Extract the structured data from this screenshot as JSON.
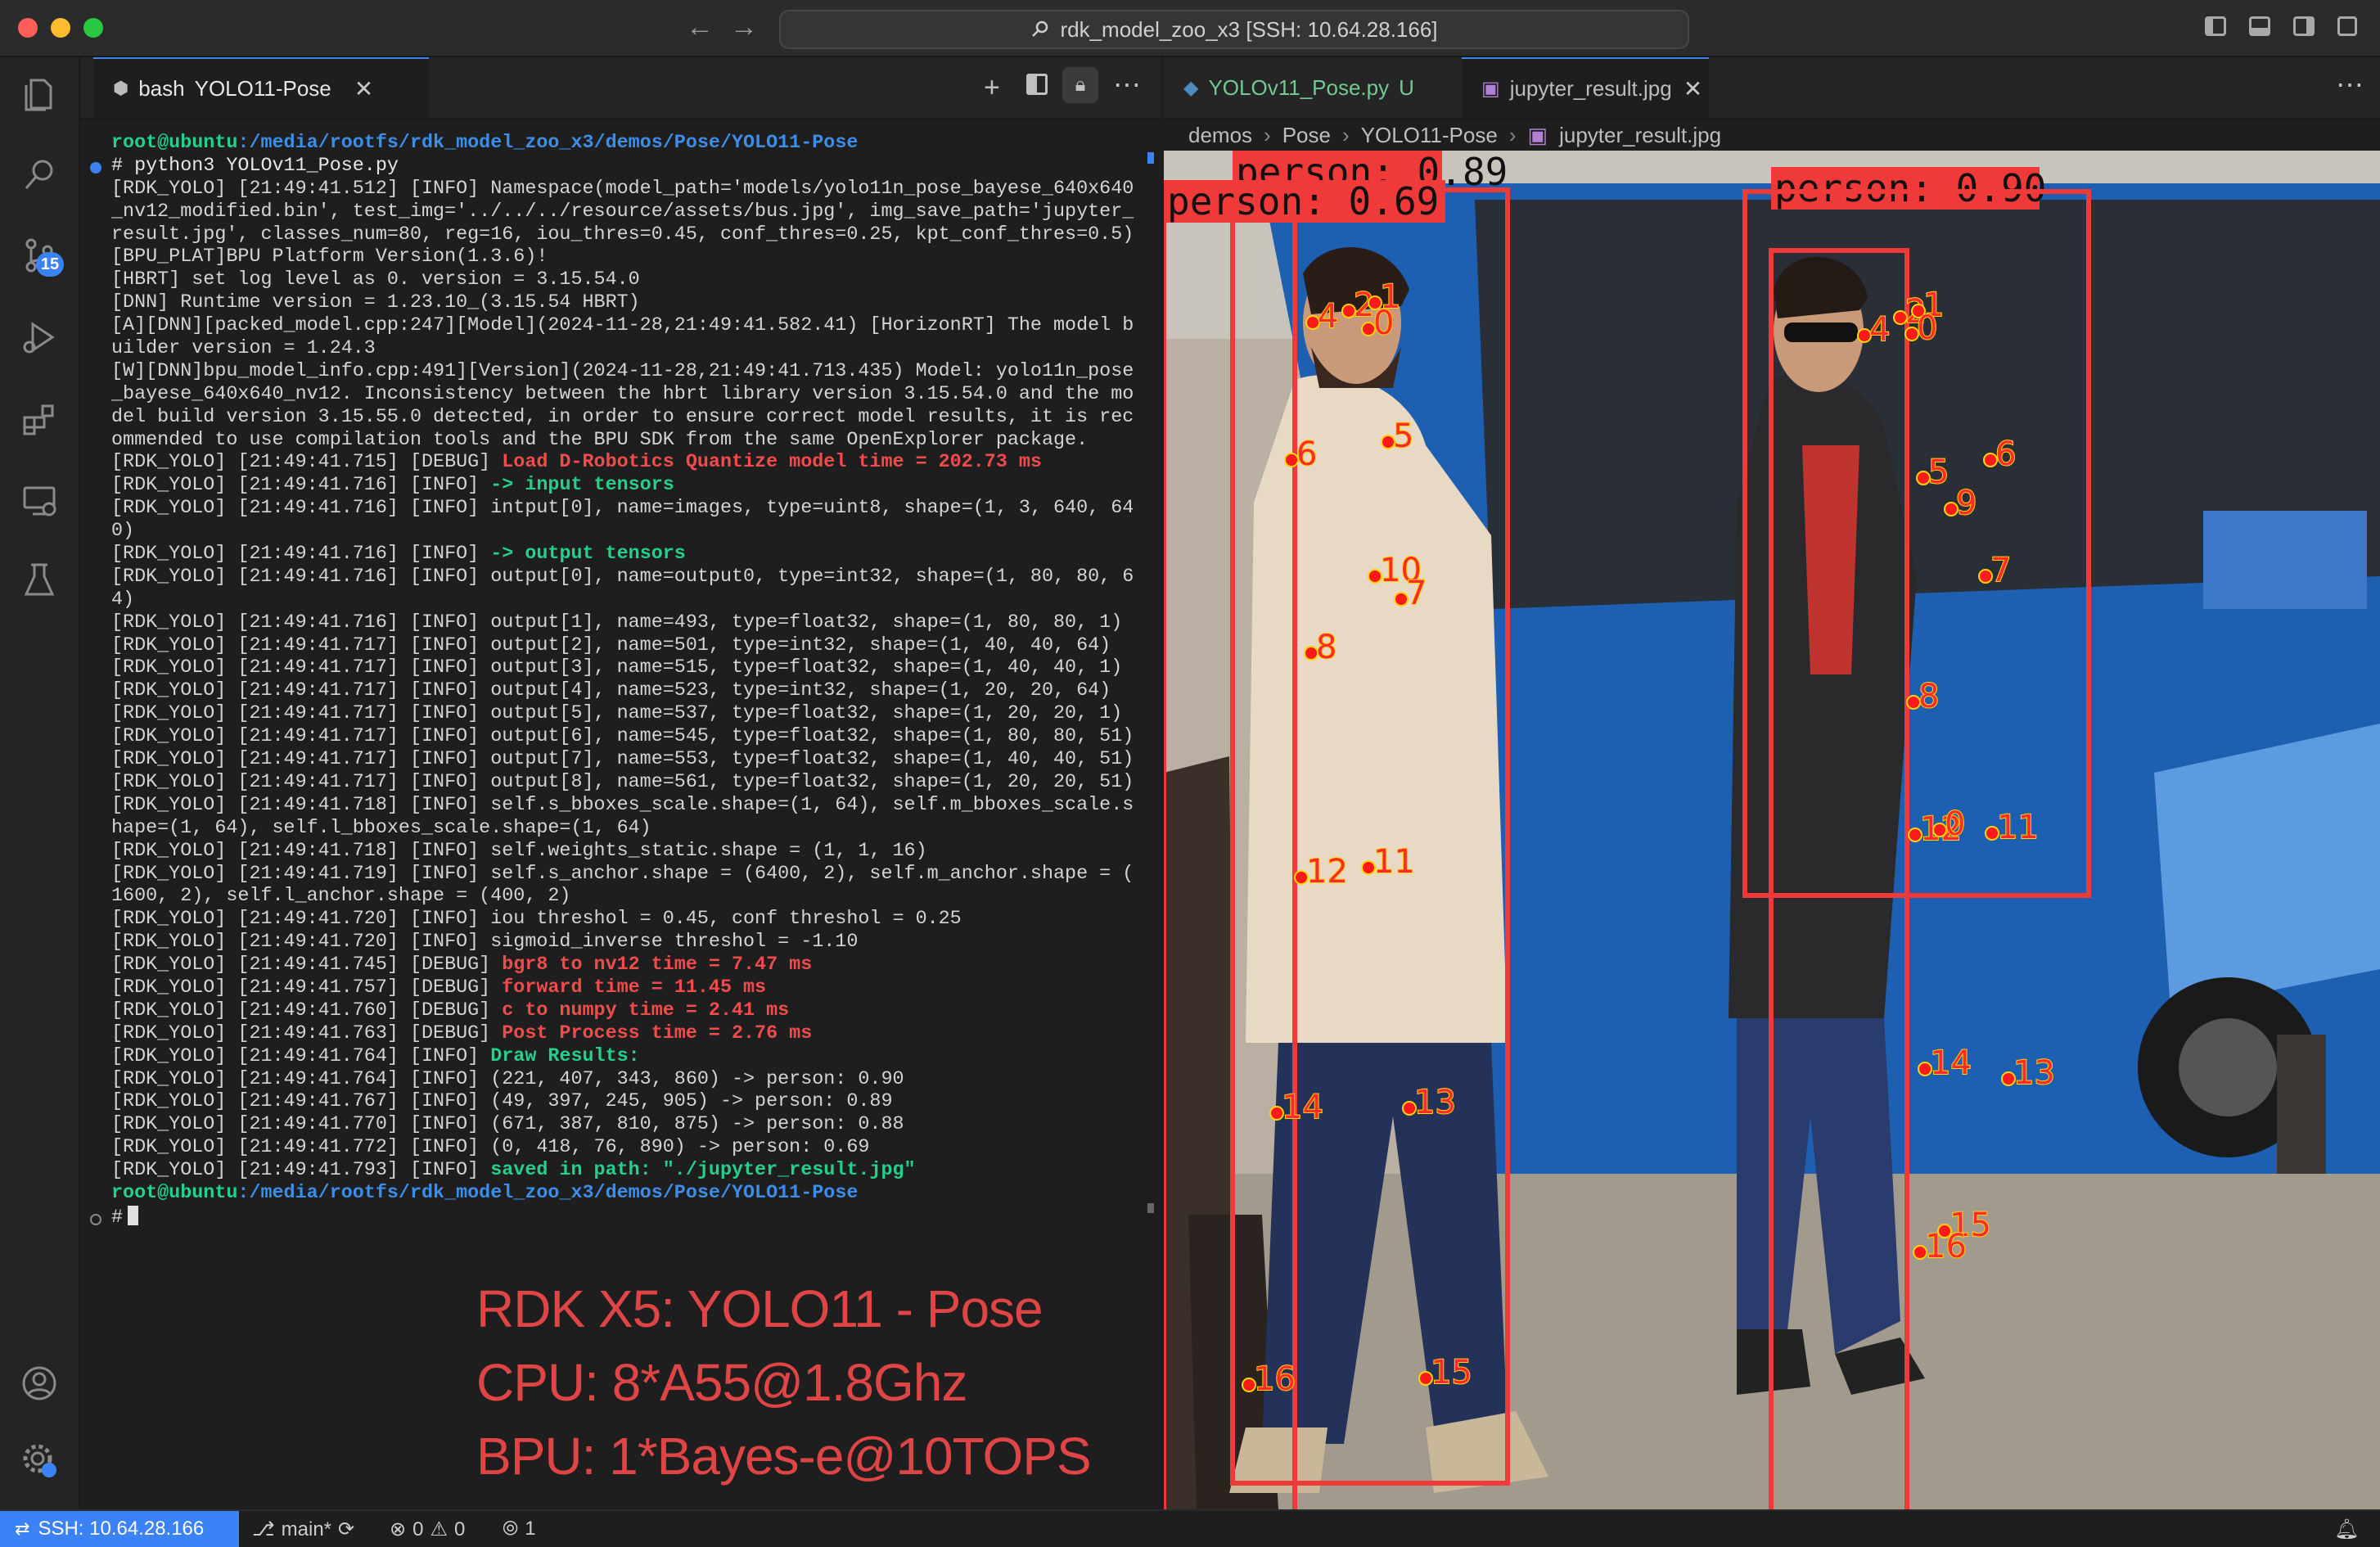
{
  "window": {
    "title": "rdk_model_zoo_x3 [SSH: 10.64.28.166]"
  },
  "activity": {
    "scm_badge": "15"
  },
  "terminal": {
    "tab_label": "bash",
    "tab_title": "YOLO11-Pose",
    "prompt_user": "root@ubuntu",
    "prompt_path": ":/media/rootfs/rdk_model_zoo_x3/demos/Pose/YOLO11-Pose",
    "command": "# python3 YOLOv11_Pose.py",
    "final_prompt": "#",
    "log_lines": [
      {
        "t": "[RDK_YOLO] [21:49:41.512] [INFO] Namespace(model_path='models/yolo11n_pose_bayese_640x640",
        "hl": ""
      },
      {
        "t": "_nv12_modified.bin', test_img='../../../resource/assets/bus.jpg', img_save_path='jupyter_",
        "hl": ""
      },
      {
        "t": "result.jpg', classes_num=80, reg=16, iou_thres=0.45, conf_thres=0.25, kpt_conf_thres=0.5)",
        "hl": ""
      },
      {
        "t": "[BPU_PLAT]BPU Platform Version(1.3.6)!",
        "hl": ""
      },
      {
        "t": "[HBRT] set log level as 0. version = 3.15.54.0",
        "hl": ""
      },
      {
        "t": "[DNN] Runtime version = 1.23.10_(3.15.54 HBRT)",
        "hl": ""
      },
      {
        "t": "[A][DNN][packed_model.cpp:247][Model](2024-11-28,21:49:41.582.41) [HorizonRT] The model b",
        "hl": ""
      },
      {
        "t": "uilder version = 1.24.3",
        "hl": ""
      },
      {
        "t": "[W][DNN]bpu_model_info.cpp:491][Version](2024-11-28,21:49:41.713.435) Model: yolo11n_pose",
        "hl": ""
      },
      {
        "t": "_bayese_640x640_nv12. Inconsistency between the hbrt library version 3.15.54.0 and the mo",
        "hl": ""
      },
      {
        "t": "del build version 3.15.55.0 detected, in order to ensure correct model results, it is rec",
        "hl": ""
      },
      {
        "t": "ommended to use compilation tools and the BPU SDK from the same OpenExplorer package.",
        "hl": ""
      },
      {
        "t": "[RDK_YOLO] [21:49:41.715] [DEBUG] ",
        "hl": "Load D-Robotics Quantize model time = 202.73 ms",
        "c": "red"
      },
      {
        "t": "[RDK_YOLO] [21:49:41.716] [INFO] ",
        "hl": "-> input tensors",
        "c": "green"
      },
      {
        "t": "[RDK_YOLO] [21:49:41.716] [INFO] intput[0], name=images, type=uint8, shape=(1, 3, 640, 64",
        "hl": ""
      },
      {
        "t": "0)",
        "hl": ""
      },
      {
        "t": "[RDK_YOLO] [21:49:41.716] [INFO] ",
        "hl": "-> output tensors",
        "c": "green"
      },
      {
        "t": "[RDK_YOLO] [21:49:41.716] [INFO] output[0], name=output0, type=int32, shape=(1, 80, 80, 6",
        "hl": ""
      },
      {
        "t": "4)",
        "hl": ""
      },
      {
        "t": "[RDK_YOLO] [21:49:41.716] [INFO] output[1], name=493, type=float32, shape=(1, 80, 80, 1)",
        "hl": ""
      },
      {
        "t": "[RDK_YOLO] [21:49:41.717] [INFO] output[2], name=501, type=int32, shape=(1, 40, 40, 64)",
        "hl": ""
      },
      {
        "t": "[RDK_YOLO] [21:49:41.717] [INFO] output[3], name=515, type=float32, shape=(1, 40, 40, 1)",
        "hl": ""
      },
      {
        "t": "[RDK_YOLO] [21:49:41.717] [INFO] output[4], name=523, type=int32, shape=(1, 20, 20, 64)",
        "hl": ""
      },
      {
        "t": "[RDK_YOLO] [21:49:41.717] [INFO] output[5], name=537, type=float32, shape=(1, 20, 20, 1)",
        "hl": ""
      },
      {
        "t": "[RDK_YOLO] [21:49:41.717] [INFO] output[6], name=545, type=float32, shape=(1, 80, 80, 51)",
        "hl": ""
      },
      {
        "t": "[RDK_YOLO] [21:49:41.717] [INFO] output[7], name=553, type=float32, shape=(1, 40, 40, 51)",
        "hl": ""
      },
      {
        "t": "[RDK_YOLO] [21:49:41.717] [INFO] output[8], name=561, type=float32, shape=(1, 20, 20, 51)",
        "hl": ""
      },
      {
        "t": "[RDK_YOLO] [21:49:41.718] [INFO] self.s_bboxes_scale.shape=(1, 64), self.m_bboxes_scale.s",
        "hl": ""
      },
      {
        "t": "hape=(1, 64), self.l_bboxes_scale.shape=(1, 64)",
        "hl": ""
      },
      {
        "t": "[RDK_YOLO] [21:49:41.718] [INFO] self.weights_static.shape = (1, 1, 16)",
        "hl": ""
      },
      {
        "t": "[RDK_YOLO] [21:49:41.719] [INFO] self.s_anchor.shape = (6400, 2), self.m_anchor.shape = (",
        "hl": ""
      },
      {
        "t": "1600, 2), self.l_anchor.shape = (400, 2)",
        "hl": ""
      },
      {
        "t": "[RDK_YOLO] [21:49:41.720] [INFO] iou threshol = 0.45, conf threshol = 0.25",
        "hl": ""
      },
      {
        "t": "[RDK_YOLO] [21:49:41.720] [INFO] sigmoid_inverse threshol = -1.10",
        "hl": ""
      },
      {
        "t": "[RDK_YOLO] [21:49:41.745] [DEBUG] ",
        "hl": "bgr8 to nv12 time = 7.47 ms",
        "c": "red"
      },
      {
        "t": "[RDK_YOLO] [21:49:41.757] [DEBUG] ",
        "hl": "forward time = 11.45 ms",
        "c": "red"
      },
      {
        "t": "[RDK_YOLO] [21:49:41.760] [DEBUG] ",
        "hl": "c to numpy time = 2.41 ms",
        "c": "red"
      },
      {
        "t": "[RDK_YOLO] [21:49:41.763] [DEBUG] ",
        "hl": "Post Process time = 2.76 ms",
        "c": "red"
      },
      {
        "t": "[RDK_YOLO] [21:49:41.764] [INFO] ",
        "hl": "Draw Results:",
        "c": "green"
      },
      {
        "t": "[RDK_YOLO] [21:49:41.764] [INFO] (221, 407, 343, 860) -> person: 0.90",
        "hl": ""
      },
      {
        "t": "[RDK_YOLO] [21:49:41.767] [INFO] (49, 397, 245, 905) -> person: 0.89",
        "hl": ""
      },
      {
        "t": "[RDK_YOLO] [21:49:41.770] [INFO] (671, 387, 810, 875) -> person: 0.88",
        "hl": ""
      },
      {
        "t": "[RDK_YOLO] [21:49:41.772] [INFO] (0, 418, 76, 890) -> person: 0.69",
        "hl": ""
      },
      {
        "t": "[RDK_YOLO] [21:49:41.793] [INFO] ",
        "hl": "saved in path: \"./jupyter_result.jpg\"",
        "c": "green"
      }
    ],
    "overlay_lines": [
      "RDK X5: YOLO11 - Pose",
      "CPU: 8*A55@1.8Ghz",
      "BPU: 1*Bayes-e@10TOPS"
    ]
  },
  "editor": {
    "tab1_label": "YOLOv11_Pose.py",
    "tab1_status": "U",
    "tab2_label": "jupyter_result.jpg",
    "breadcrumb": [
      "demos",
      "Pose",
      "YOLO11-Pose",
      "jupyter_result.jpg"
    ]
  },
  "image": {
    "detections": [
      {
        "label": "person: 0.89"
      },
      {
        "label": "person: 0.69"
      },
      {
        "label": "person: 0.90"
      }
    ],
    "keypoint_labels": [
      "4",
      "2",
      "1",
      "0",
      "5",
      "6",
      "10",
      "7",
      "8",
      "12",
      "11",
      "14",
      "13",
      "16",
      "15",
      "4",
      "2",
      "1",
      "0",
      "6",
      "5",
      "9",
      "7",
      "8",
      "12",
      "0",
      "11",
      "14",
      "13",
      "15",
      "16"
    ]
  },
  "status": {
    "remote": "SSH: 10.64.28.166",
    "branch": "main*",
    "errors": "0",
    "warnings": "0",
    "ports": "1"
  },
  "colors": {
    "accent": "#3b82f6",
    "box_red": "#f03a3a",
    "kpt_label": "#ffd400",
    "overlay_text": "#e04545"
  }
}
